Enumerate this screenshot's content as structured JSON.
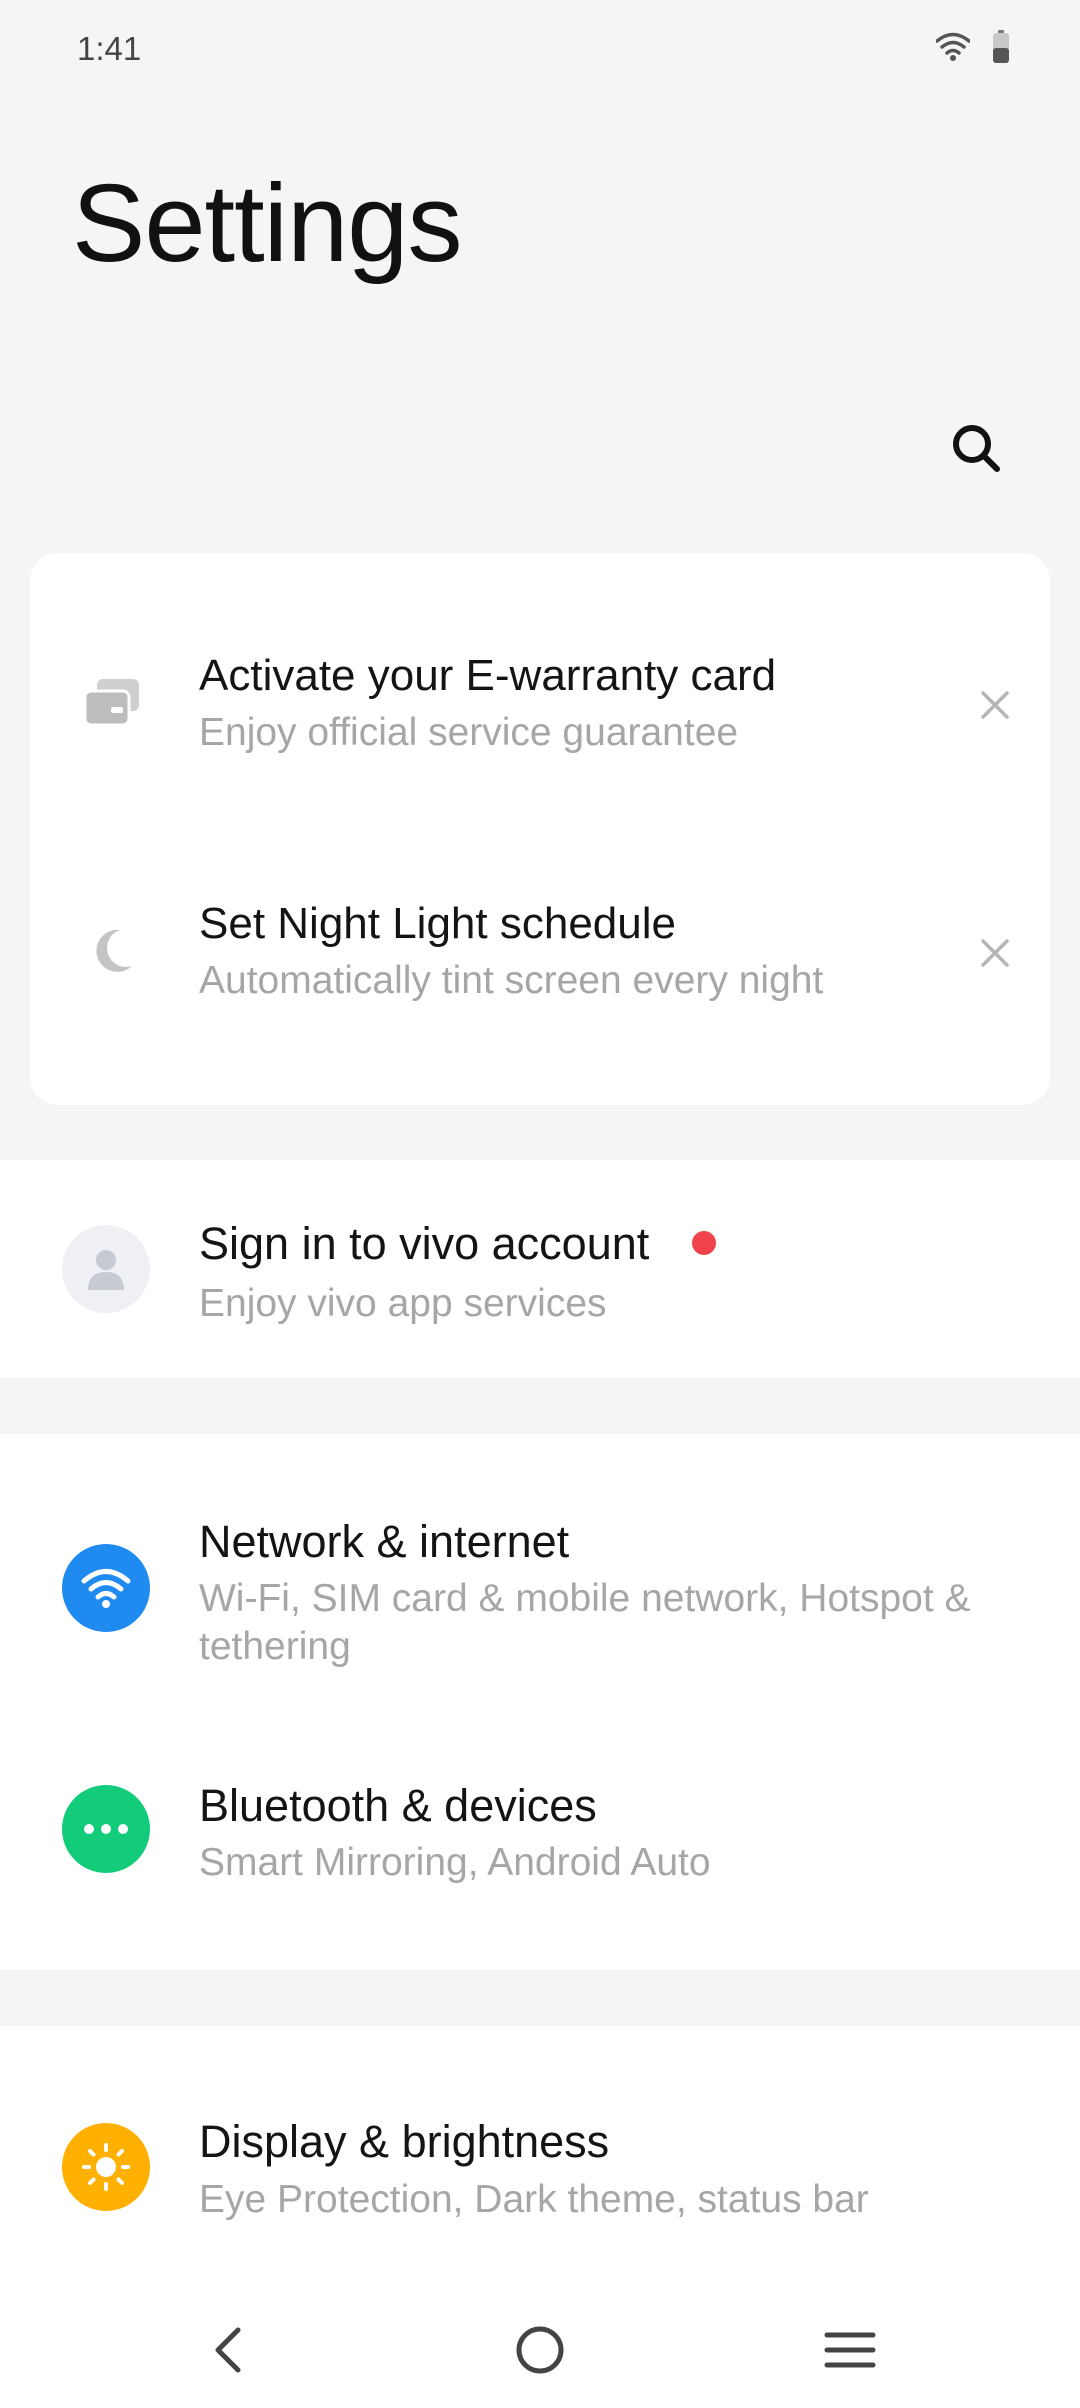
{
  "status_bar": {
    "time": "1:41",
    "wifi_icon": "wifi-icon",
    "battery_icon": "battery-icon"
  },
  "header": {
    "title": "Settings",
    "search_icon": "search-icon"
  },
  "suggestions": [
    {
      "title": "Activate your E-warranty card",
      "subtitle": "Enjoy official service guarantee",
      "icon": "card-icon",
      "dismiss_icon": "close-icon"
    },
    {
      "title": "Set Night Light schedule",
      "subtitle": "Automatically tint screen every night",
      "icon": "moon-icon",
      "dismiss_icon": "close-icon"
    }
  ],
  "account": {
    "title": "Sign in to vivo account",
    "subtitle": "Enjoy vivo app services",
    "icon": "person-icon",
    "badge_color": "#f0424a"
  },
  "connectivity": [
    {
      "title": "Network & internet",
      "subtitle": "Wi-Fi, SIM card & mobile network, Hotspot & tethering",
      "icon": "wifi-icon",
      "color": "#1f8af0"
    },
    {
      "title": "Bluetooth & devices",
      "subtitle": "Smart Mirroring, Android Auto",
      "icon": "more-dots-icon",
      "color": "#12cc7a"
    }
  ],
  "display": [
    {
      "title": "Display & brightness",
      "subtitle": "Eye Protection, Dark theme, status bar",
      "icon": "sun-icon",
      "color": "#ffb000"
    }
  ],
  "nav_bar": {
    "back_icon": "back-icon",
    "home_icon": "home-icon",
    "menu_icon": "menu-icon"
  }
}
